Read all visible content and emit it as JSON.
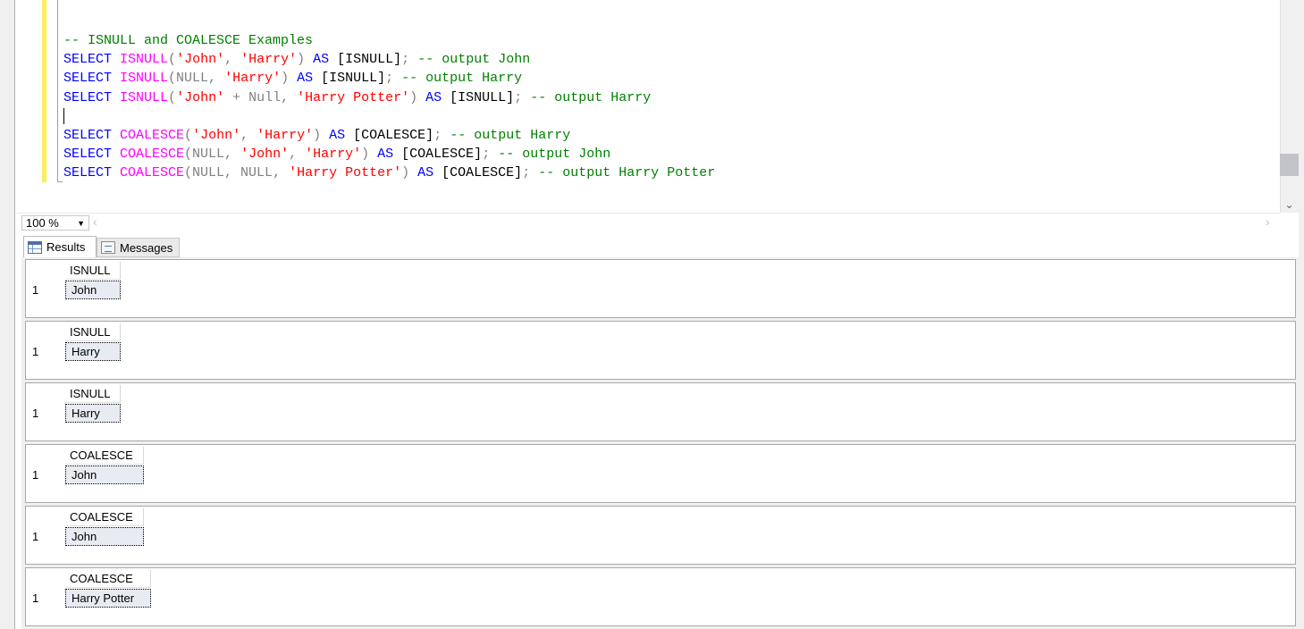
{
  "editor": {
    "lines": [
      [
        {
          "t": "-- ISNULL and COALESCE Examples",
          "c": "cm"
        }
      ],
      [
        {
          "t": "SELECT",
          "c": "kw"
        },
        {
          "t": " ",
          "c": "plain"
        },
        {
          "t": "ISNULL",
          "c": "fn"
        },
        {
          "t": "(",
          "c": "gray"
        },
        {
          "t": "'John'",
          "c": "str"
        },
        {
          "t": ", ",
          "c": "gray"
        },
        {
          "t": "'Harry'",
          "c": "str"
        },
        {
          "t": ")",
          "c": "gray"
        },
        {
          "t": " ",
          "c": "plain"
        },
        {
          "t": "AS",
          "c": "kw"
        },
        {
          "t": " [ISNULL]",
          "c": "plain"
        },
        {
          "t": ";",
          "c": "gray"
        },
        {
          "t": " -- output John",
          "c": "cm"
        }
      ],
      [
        {
          "t": "SELECT",
          "c": "kw"
        },
        {
          "t": " ",
          "c": "plain"
        },
        {
          "t": "ISNULL",
          "c": "fn"
        },
        {
          "t": "(NULL, ",
          "c": "gray"
        },
        {
          "t": "'Harry'",
          "c": "str"
        },
        {
          "t": ")",
          "c": "gray"
        },
        {
          "t": " ",
          "c": "plain"
        },
        {
          "t": "AS",
          "c": "kw"
        },
        {
          "t": " [ISNULL]",
          "c": "plain"
        },
        {
          "t": ";",
          "c": "gray"
        },
        {
          "t": " -- output Harry",
          "c": "cm"
        }
      ],
      [
        {
          "t": "SELECT",
          "c": "kw"
        },
        {
          "t": " ",
          "c": "plain"
        },
        {
          "t": "ISNULL",
          "c": "fn"
        },
        {
          "t": "(",
          "c": "gray"
        },
        {
          "t": "'John'",
          "c": "str"
        },
        {
          "t": " + Null, ",
          "c": "gray"
        },
        {
          "t": "'Harry Potter'",
          "c": "str"
        },
        {
          "t": ")",
          "c": "gray"
        },
        {
          "t": " ",
          "c": "plain"
        },
        {
          "t": "AS",
          "c": "kw"
        },
        {
          "t": " [ISNULL]",
          "c": "plain"
        },
        {
          "t": ";",
          "c": "gray"
        },
        {
          "t": " -- output Harry",
          "c": "cm"
        }
      ],
      [],
      [
        {
          "t": "SELECT",
          "c": "kw"
        },
        {
          "t": " ",
          "c": "plain"
        },
        {
          "t": "COALESCE",
          "c": "fn"
        },
        {
          "t": "(",
          "c": "gray"
        },
        {
          "t": "'John'",
          "c": "str"
        },
        {
          "t": ", ",
          "c": "gray"
        },
        {
          "t": "'Harry'",
          "c": "str"
        },
        {
          "t": ")",
          "c": "gray"
        },
        {
          "t": " ",
          "c": "plain"
        },
        {
          "t": "AS",
          "c": "kw"
        },
        {
          "t": " [COALESCE]",
          "c": "plain"
        },
        {
          "t": ";",
          "c": "gray"
        },
        {
          "t": " -- output Harry",
          "c": "cm"
        }
      ],
      [
        {
          "t": "SELECT",
          "c": "kw"
        },
        {
          "t": " ",
          "c": "plain"
        },
        {
          "t": "COALESCE",
          "c": "fn"
        },
        {
          "t": "(NULL, ",
          "c": "gray"
        },
        {
          "t": "'John'",
          "c": "str"
        },
        {
          "t": ", ",
          "c": "gray"
        },
        {
          "t": "'Harry'",
          "c": "str"
        },
        {
          "t": ")",
          "c": "gray"
        },
        {
          "t": " ",
          "c": "plain"
        },
        {
          "t": "AS",
          "c": "kw"
        },
        {
          "t": " [COALESCE]",
          "c": "plain"
        },
        {
          "t": ";",
          "c": "gray"
        },
        {
          "t": " -- output John",
          "c": "cm"
        }
      ],
      [
        {
          "t": "SELECT",
          "c": "kw"
        },
        {
          "t": " ",
          "c": "plain"
        },
        {
          "t": "COALESCE",
          "c": "fn"
        },
        {
          "t": "(NULL, NULL, ",
          "c": "gray"
        },
        {
          "t": "'Harry Potter'",
          "c": "str"
        },
        {
          "t": ")",
          "c": "gray"
        },
        {
          "t": " ",
          "c": "plain"
        },
        {
          "t": "AS",
          "c": "kw"
        },
        {
          "t": " [COALESCE]",
          "c": "plain"
        },
        {
          "t": ";",
          "c": "gray"
        },
        {
          "t": " -- output Harry Potter",
          "c": "cm"
        }
      ]
    ]
  },
  "zoom": {
    "value": "100 %"
  },
  "tabs": {
    "results": "Results",
    "messages": "Messages"
  },
  "results": [
    {
      "column": "ISNULL",
      "row_number": "1",
      "value": "John"
    },
    {
      "column": "ISNULL",
      "row_number": "1",
      "value": "Harry"
    },
    {
      "column": "ISNULL",
      "row_number": "1",
      "value": "Harry"
    },
    {
      "column": "COALESCE",
      "row_number": "1",
      "value": "John"
    },
    {
      "column": "COALESCE",
      "row_number": "1",
      "value": "John"
    },
    {
      "column": "COALESCE",
      "row_number": "1",
      "value": "Harry Potter"
    }
  ],
  "colors": {
    "keyword": "#0000ff",
    "function": "#ff00ff",
    "string": "#ff0000",
    "comment": "#008000",
    "change_bar": "#f7f056"
  }
}
